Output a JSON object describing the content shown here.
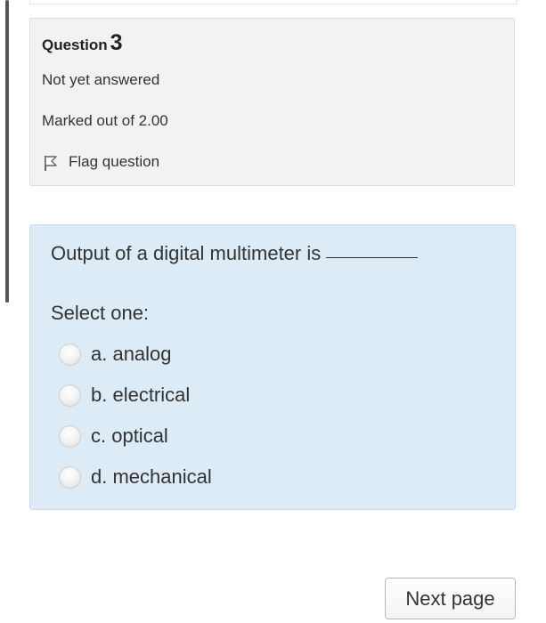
{
  "question_info": {
    "heading_label": "Question",
    "number": "3",
    "state": "Not yet answered",
    "grade": "Marked out of 2.00",
    "flag_label": "Flag question",
    "flag_icon": "flag-icon"
  },
  "question": {
    "text": "Output of a digital multimeter is",
    "prompt": "Select one:",
    "answers": [
      {
        "label": "a. analog"
      },
      {
        "label": "b. electrical"
      },
      {
        "label": "c. optical"
      },
      {
        "label": "d. mechanical"
      }
    ]
  },
  "navigation": {
    "next_label": "Next page"
  },
  "colors": {
    "content_background": "#dcebf6",
    "info_background": "#f2f2f2"
  }
}
